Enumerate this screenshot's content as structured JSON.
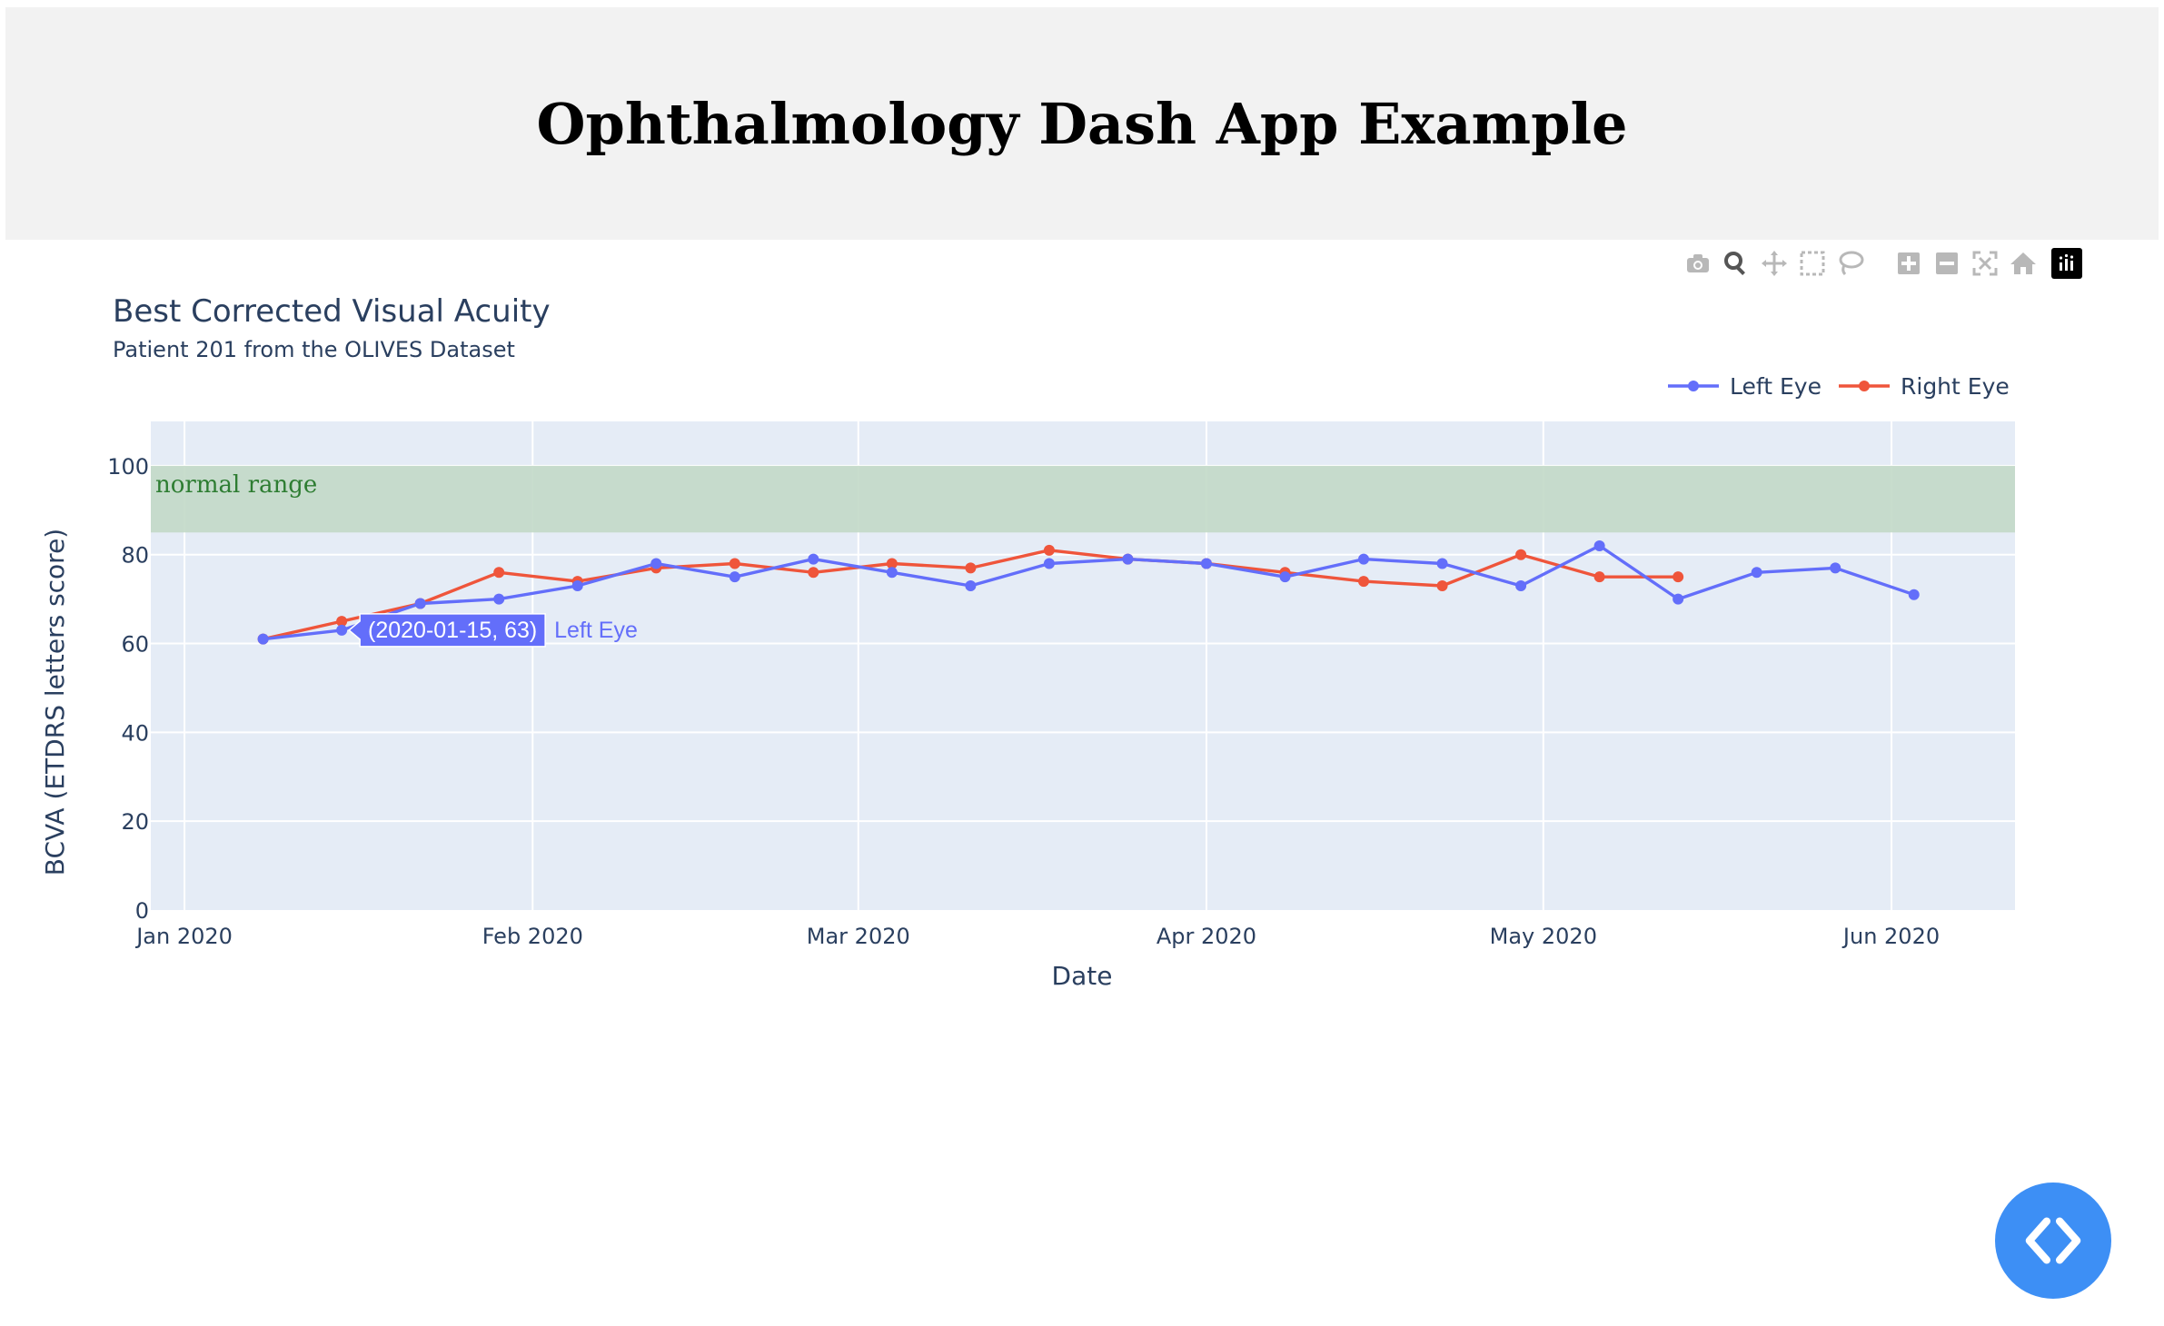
{
  "page_title": "Ophthalmology Dash App Example",
  "modebar": {
    "icons": [
      "camera-icon",
      "zoom-icon",
      "pan-icon",
      "box-select-icon",
      "lasso-icon",
      "zoom-in-icon",
      "zoom-out-icon",
      "autoscale-icon",
      "reset-axes-icon",
      "plotly-logo-icon"
    ]
  },
  "colors": {
    "left_eye": "#636efa",
    "right_eye": "#ef553b",
    "plot_bg": "#e5ecf6",
    "normal_range_fill": "#c2d9c8",
    "normal_range_text": "#2e7d32",
    "code_button": "#3d8ff5"
  },
  "chart_data": {
    "type": "line",
    "title": "Best Corrected Visual Acuity",
    "subtitle": "Patient 201 from the OLIVES Dataset",
    "xlabel": "Date",
    "ylabel": "BCVA (ETDRS letters score)",
    "xlim": [
      "2019-12-29",
      "2020-06-12"
    ],
    "ylim": [
      0,
      110
    ],
    "x_ticks": [
      {
        "date": "2020-01-01",
        "label": "Jan 2020"
      },
      {
        "date": "2020-02-01",
        "label": "Feb 2020"
      },
      {
        "date": "2020-03-01",
        "label": "Mar 2020"
      },
      {
        "date": "2020-04-01",
        "label": "Apr 2020"
      },
      {
        "date": "2020-05-01",
        "label": "May 2020"
      },
      {
        "date": "2020-06-01",
        "label": "Jun 2020"
      }
    ],
    "y_ticks": [
      0,
      20,
      40,
      60,
      80,
      100
    ],
    "grid": true,
    "legend_position": "top-right",
    "shapes": [
      {
        "type": "band",
        "y0": 85,
        "y1": 100,
        "label": "normal range"
      }
    ],
    "series": [
      {
        "name": "Left Eye",
        "color": "#636efa",
        "x": [
          "2020-01-08",
          "2020-01-15",
          "2020-01-22",
          "2020-01-29",
          "2020-02-05",
          "2020-02-12",
          "2020-02-19",
          "2020-02-26",
          "2020-03-04",
          "2020-03-11",
          "2020-03-18",
          "2020-03-25",
          "2020-04-01",
          "2020-04-08",
          "2020-04-15",
          "2020-04-22",
          "2020-04-29",
          "2020-05-06",
          "2020-05-13",
          "2020-05-20",
          "2020-05-27",
          "2020-06-03"
        ],
        "y": [
          61,
          63,
          69,
          70,
          73,
          78,
          75,
          79,
          76,
          73,
          78,
          79,
          78,
          75,
          79,
          78,
          73,
          82,
          70,
          76,
          77,
          71
        ]
      },
      {
        "name": "Right Eye",
        "color": "#ef553b",
        "x": [
          "2020-01-08",
          "2020-01-15",
          "2020-01-22",
          "2020-01-29",
          "2020-02-05",
          "2020-02-12",
          "2020-02-19",
          "2020-02-26",
          "2020-03-04",
          "2020-03-11",
          "2020-03-18",
          "2020-03-25",
          "2020-04-01",
          "2020-04-08",
          "2020-04-15",
          "2020-04-22",
          "2020-04-29",
          "2020-05-06",
          "2020-05-13"
        ],
        "y": [
          61,
          65,
          69,
          76,
          74,
          77,
          78,
          76,
          78,
          77,
          81,
          79,
          78,
          76,
          74,
          73,
          80,
          75,
          75
        ]
      }
    ],
    "hover": {
      "label": "(2020-01-15, 63)",
      "series": "Left Eye"
    }
  }
}
